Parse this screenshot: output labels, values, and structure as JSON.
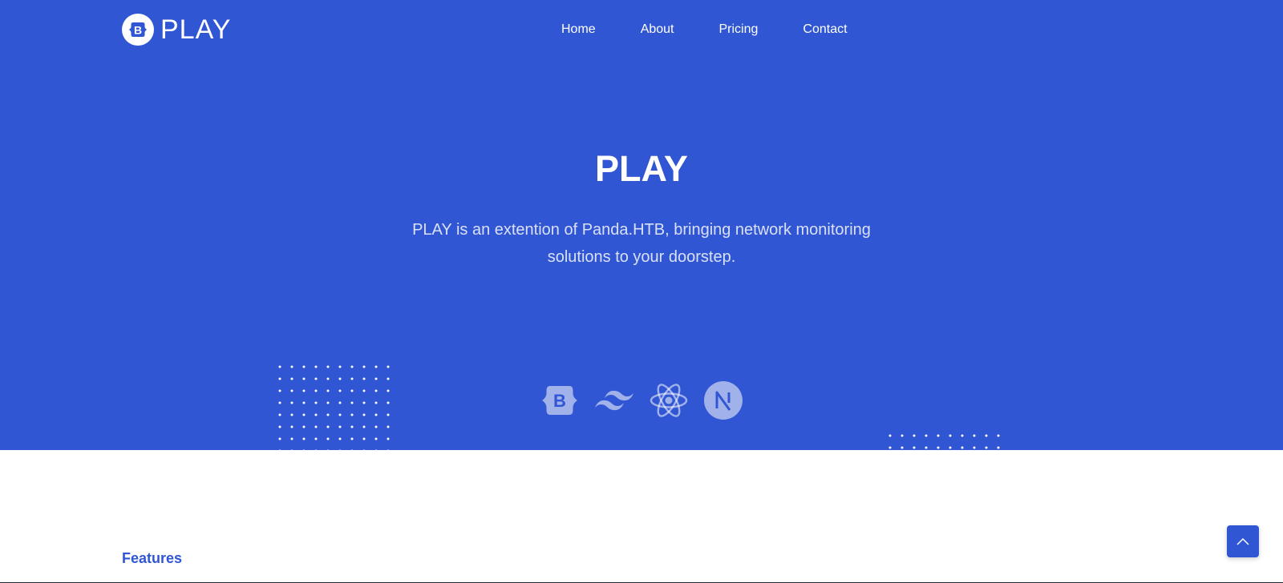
{
  "brand": {
    "logo_letter": "B",
    "name": "PLAY"
  },
  "nav": {
    "items": [
      {
        "label": "Home"
      },
      {
        "label": "About"
      },
      {
        "label": "Pricing"
      },
      {
        "label": "Contact"
      }
    ]
  },
  "hero": {
    "title": "PLAY",
    "description": "PLAY is an extention of Panda.HTB, bringing network monitoring solutions to your doorstep."
  },
  "tech_icons": [
    "bootstrap-icon",
    "tailwind-icon",
    "react-icon",
    "nextjs-icon"
  ],
  "features": {
    "label": "Features"
  },
  "colors": {
    "primary": "#3056d3",
    "white": "#ffffff"
  },
  "icons": {
    "back_to_top": "chevron-up-icon"
  }
}
